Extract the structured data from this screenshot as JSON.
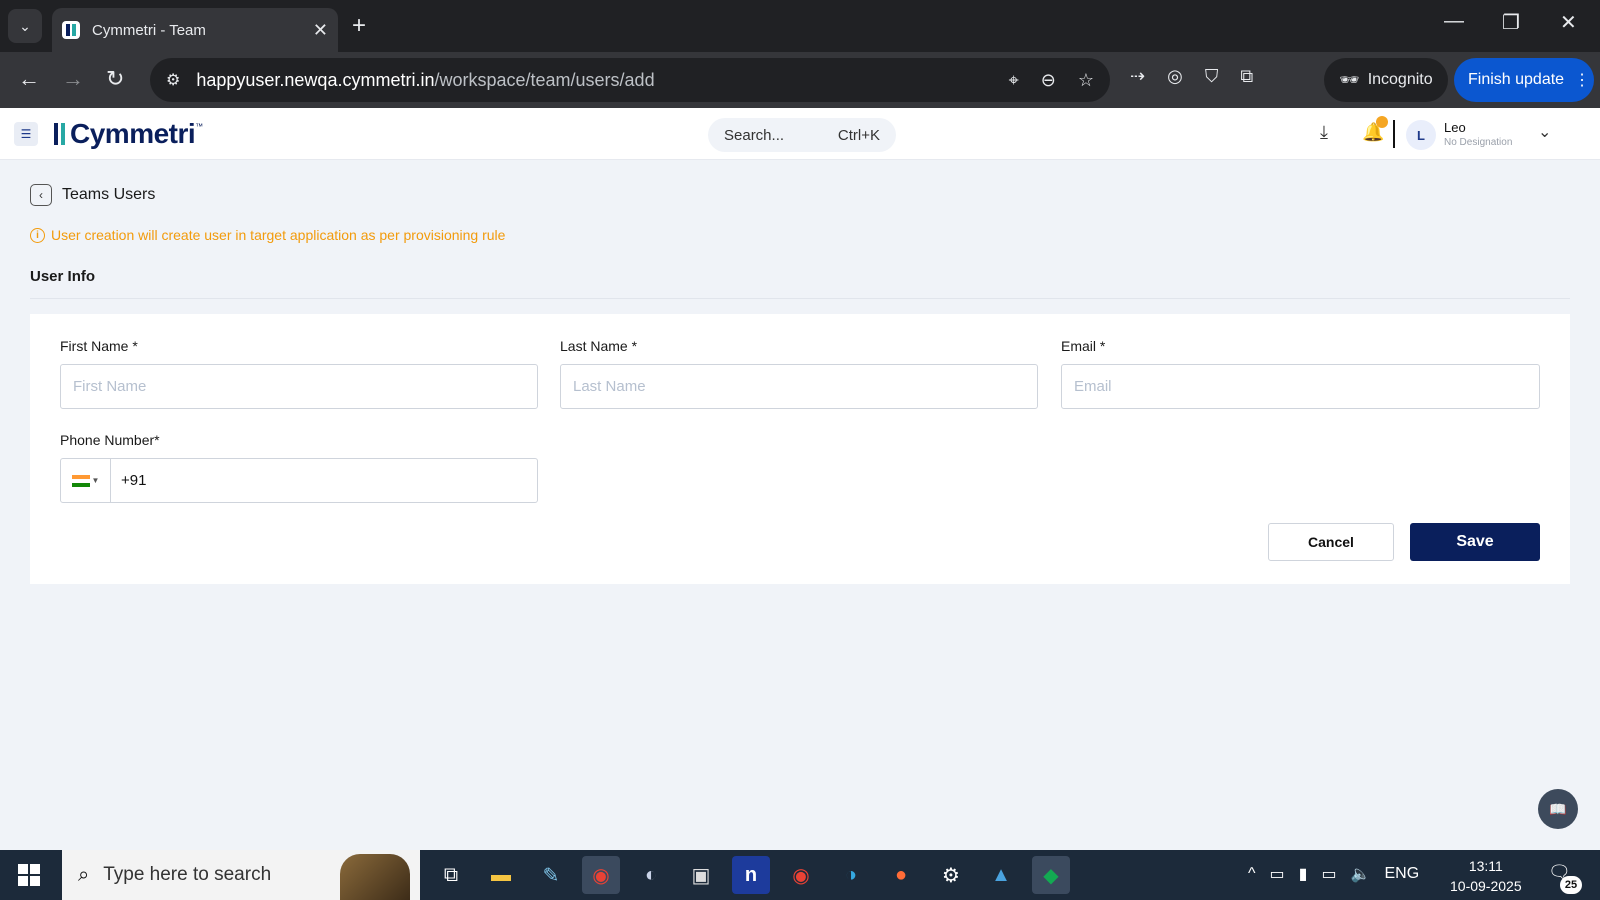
{
  "browser": {
    "tab_title": "Cymmetri - Team",
    "new_tab_icon": "plus-icon",
    "url_host": "happyuser.newqa.cymmetri.in",
    "url_path": "/workspace/team/users/add",
    "incognito_label": "Incognito",
    "finish_update_label": "Finish update"
  },
  "app": {
    "logo_text": "Cymmetri",
    "logo_tm": "™",
    "search_placeholder": "Search...",
    "search_shortcut": "Ctrl+K",
    "user_initial": "L",
    "user_name": "Leo",
    "user_designation": "No Designation"
  },
  "page": {
    "back_title": "Teams Users",
    "notice": "User creation will create user in target application as per provisioning rule",
    "section_title": "User Info"
  },
  "form": {
    "first_name_label": "First Name *",
    "first_name_placeholder": "First Name",
    "last_name_label": "Last Name *",
    "last_name_placeholder": "Last Name",
    "email_label": "Email *",
    "email_placeholder": "Email",
    "phone_label": "Phone Number*",
    "phone_value": "+91",
    "cancel_label": "Cancel",
    "save_label": "Save"
  },
  "taskbar": {
    "search_placeholder": "Type here to search",
    "language": "ENG",
    "time": "13:11",
    "date": "10-09-2025",
    "notification_count": "25"
  },
  "colors": {
    "brand_navy": "#0a1f5c",
    "brand_teal": "#27a8a4",
    "notice_orange": "#f29b0c"
  }
}
